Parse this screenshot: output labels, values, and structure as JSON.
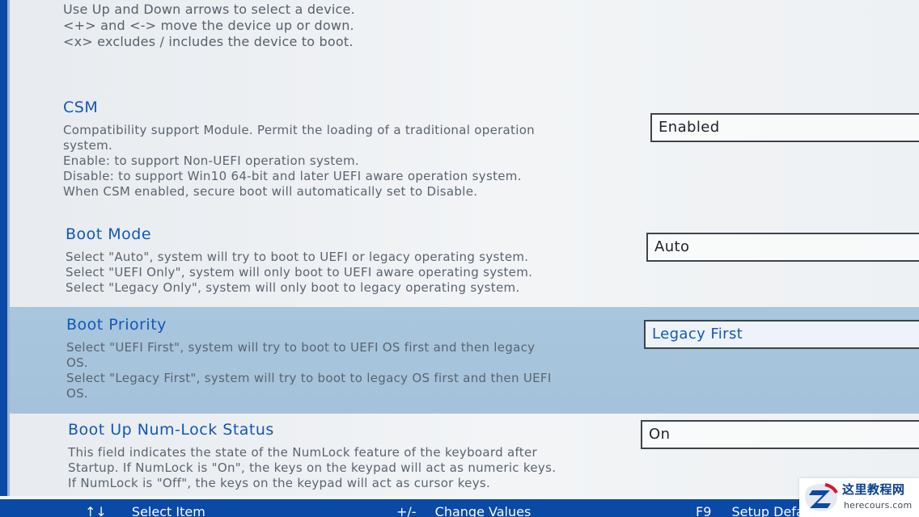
{
  "help": {
    "lines": [
      "Use Up and Down arrows to select a device.",
      "<+> and <-> move the device up or down.",
      "<x> excludes / includes the device to boot."
    ]
  },
  "settings": [
    {
      "title": "CSM",
      "value": "Enabled",
      "description": [
        "Compatibility support Module. Permit the loading of a traditional operation",
        "system.",
        "Enable: to support Non-UEFI operation system.",
        "Disable: to support Win10 64-bit and later UEFI aware operation system.",
        "When CSM enabled, secure boot will automatically set to Disable."
      ]
    },
    {
      "title": "Boot Mode",
      "value": "Auto",
      "description": [
        "Select \"Auto\", system will try to boot to UEFI or legacy operating system.",
        "Select \"UEFI Only\", system will only boot to UEFI aware operating system.",
        "Select \"Legacy Only\", system will only boot to legacy operating system."
      ]
    },
    {
      "title": "Boot Priority",
      "value": "Legacy First",
      "description": [
        "Select \"UEFI First\", system will try to boot to UEFI OS first and then legacy",
        "OS.",
        "Select \"Legacy First\", system will try to boot to legacy OS first and then UEFI",
        "OS."
      ]
    },
    {
      "title": "Boot Up Num-Lock Status",
      "value": "On",
      "description": [
        "This field indicates the state of the NumLock feature of the keyboard after",
        "Startup. If NumLock is \"On\", the keys on the keypad will act as numeric keys.",
        "If NumLock is \"Off\", the keys on the keypad will act as cursor keys."
      ]
    }
  ],
  "footer": {
    "items": [
      {
        "key": "↑↓",
        "label": "Select Item"
      },
      {
        "key": "+/-",
        "label": "Change Values"
      },
      {
        "key": "F9",
        "label": "Setup Defau"
      }
    ]
  },
  "watermark": {
    "title": "这里教程网",
    "site": "herecours.com",
    "logo_letter": "Z"
  },
  "colors": {
    "bios_blue": "#0b49a6",
    "setting_title": "#1257b8",
    "selected_row": "#a8c6dd"
  }
}
